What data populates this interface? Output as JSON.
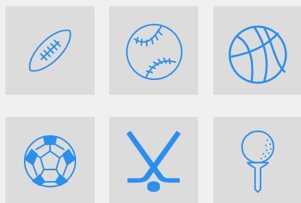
{
  "accent_color": "#2b8ff0",
  "tile_color": "#dcdcdc",
  "background_color": "#f0f0f0",
  "icons": [
    {
      "name": "american-football-icon"
    },
    {
      "name": "baseball-icon"
    },
    {
      "name": "basketball-icon"
    },
    {
      "name": "soccer-ball-icon"
    },
    {
      "name": "hockey-sticks-icon"
    },
    {
      "name": "golf-ball-on-tee-icon"
    }
  ]
}
